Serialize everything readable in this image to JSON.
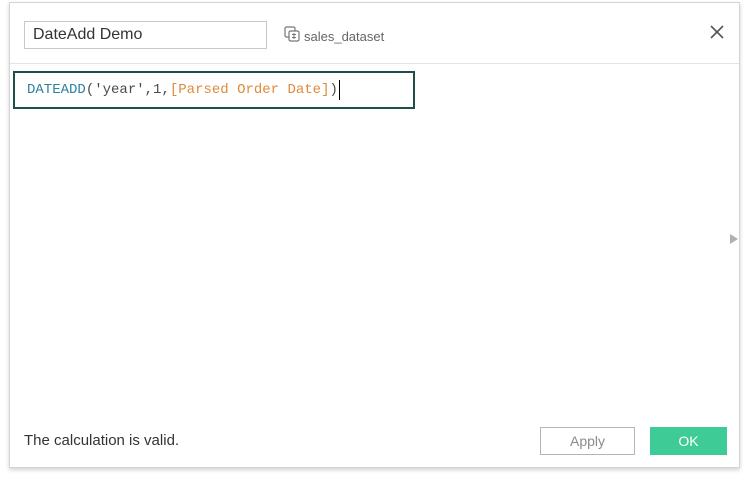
{
  "dialog": {
    "calc_name": "DateAdd Demo",
    "datasource": {
      "icon": "datasource-icon",
      "label": "sales_dataset"
    },
    "close_icon": "close-icon"
  },
  "formula": {
    "function": "DATEADD",
    "open_paren": "(",
    "string_arg": "'year'",
    "comma1": ",",
    "number_arg": "1",
    "comma2": ",",
    "field_arg": "[Parsed Order Date]",
    "close_paren": ")"
  },
  "footer": {
    "status": "The calculation is valid.",
    "apply_label": "Apply",
    "ok_label": "OK"
  },
  "colors": {
    "function": "#2e7fa0",
    "field": "#e0893a",
    "border_active": "#1f4f4b",
    "ok_button": "#3fcb96"
  }
}
